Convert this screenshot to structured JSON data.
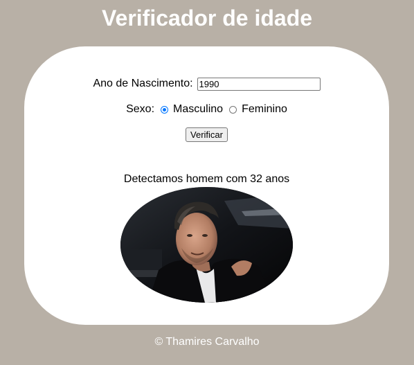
{
  "header": {
    "title": "Verificador de idade"
  },
  "form": {
    "birth_label": "Ano de Nascimento:",
    "birth_value": "1990",
    "sex_label": "Sexo:",
    "options": [
      {
        "label": "Masculino",
        "checked": true
      },
      {
        "label": "Feminino",
        "checked": false
      }
    ],
    "button_label": "Verificar"
  },
  "result": {
    "text": "Detectamos homem com 32 anos",
    "photo_description": "photo-of-man"
  },
  "footer": {
    "text": "© Thamires Carvalho"
  },
  "colors": {
    "background": "#b8b0a6",
    "panel": "#ffffff",
    "accent": "#0075ff"
  }
}
